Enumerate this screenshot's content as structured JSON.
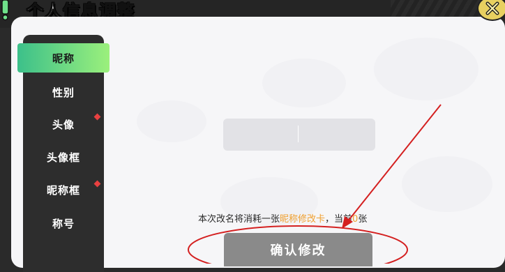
{
  "header": {
    "title": "个人信息调整"
  },
  "colors": {
    "accent_green": "#5fdc7a",
    "highlight_orange": "#f0a030",
    "annotation_red": "#d42020"
  },
  "icons": {
    "close": "close-x-icon",
    "badge": "exclamation-badge-icon"
  },
  "sidebar": {
    "items": [
      {
        "label": "昵称",
        "active": true,
        "has_dot": false
      },
      {
        "label": "性别",
        "active": false,
        "has_dot": false
      },
      {
        "label": "头像",
        "active": false,
        "has_dot": true
      },
      {
        "label": "头像框",
        "active": false,
        "has_dot": false
      },
      {
        "label": "昵称框",
        "active": false,
        "has_dot": true
      },
      {
        "label": "称号",
        "active": false,
        "has_dot": false
      }
    ]
  },
  "main": {
    "name_input": {
      "value": "",
      "placeholder": ""
    },
    "notice": {
      "prefix": "本次改名将消耗一张",
      "card": "昵称修改卡",
      "middle": "，当前",
      "count": "0",
      "suffix": "张"
    },
    "confirm_label": "确认修改"
  }
}
